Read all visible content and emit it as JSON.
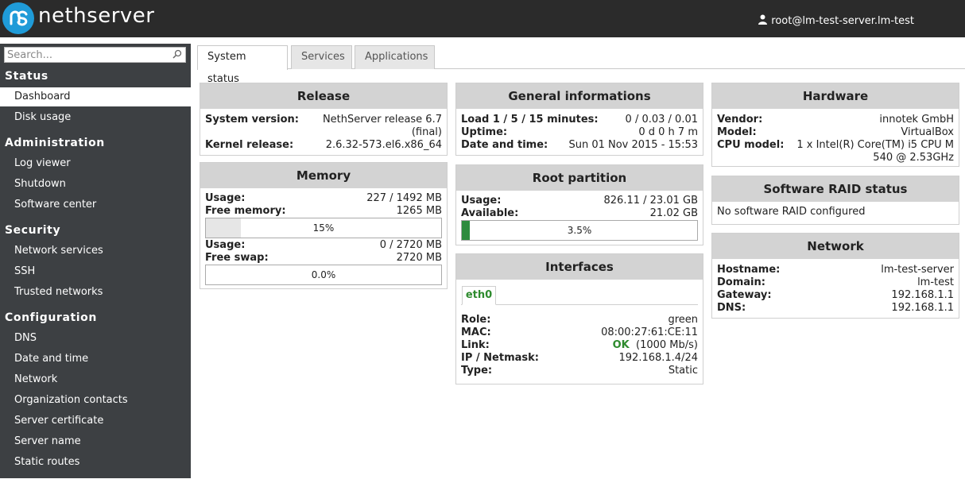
{
  "header": {
    "brand": "nethserver",
    "user": "root@lm-test-server.lm-test"
  },
  "sidebar": {
    "search_placeholder": "Search...",
    "sections": [
      {
        "title": "Status",
        "items": [
          "Dashboard",
          "Disk usage"
        ]
      },
      {
        "title": "Administration",
        "items": [
          "Log viewer",
          "Shutdown",
          "Software center"
        ]
      },
      {
        "title": "Security",
        "items": [
          "Network services",
          "SSH",
          "Trusted networks"
        ]
      },
      {
        "title": "Configuration",
        "items": [
          "DNS",
          "Date and time",
          "Network",
          "Organization contacts",
          "Server certificate",
          "Server name",
          "Static routes"
        ]
      }
    ],
    "active_item": "Dashboard"
  },
  "tabs": [
    "System status",
    "Services",
    "Applications"
  ],
  "release": {
    "title": "Release",
    "system_version_label": "System version:",
    "system_version_line1": "NethServer release 6.7",
    "system_version_line2": "(final)",
    "kernel_label": "Kernel release:",
    "kernel_value": "2.6.32-573.el6.x86_64"
  },
  "memory": {
    "title": "Memory",
    "usage_label": "Usage:",
    "usage_value": "227 / 1492 MB",
    "free_label": "Free memory:",
    "free_value": "1265 MB",
    "mem_bar_label": "15%",
    "mem_bar_fraction": 0.15,
    "swap_usage_label": "Usage:",
    "swap_usage_value": "0 / 2720 MB",
    "free_swap_label": "Free swap:",
    "free_swap_value": "2720 MB",
    "swap_bar_label": "0.0%",
    "swap_bar_fraction": 0.0,
    "mem_bar_color": "#e6e6e6"
  },
  "general": {
    "title": "General informations",
    "load_label": "Load 1 / 5 / 15 minutes:",
    "load_value": "0 / 0.03 / 0.01",
    "uptime_label": "Uptime:",
    "uptime_value": "0 d 0 h 7 m",
    "date_label": "Date and time:",
    "date_value": "Sun 01 Nov 2015 - 15:53"
  },
  "root_partition": {
    "title": "Root partition",
    "usage_label": "Usage:",
    "usage_value": "826.11 / 23.01 GB",
    "available_label": "Available:",
    "available_value": "21.02 GB",
    "bar_label": "3.5%",
    "bar_fraction": 0.035,
    "bar_color": "#2e8b3e"
  },
  "interfaces": {
    "title": "Interfaces",
    "tab": "eth0",
    "role_label": "Role:",
    "role_value": "green",
    "mac_label": "MAC:",
    "mac_value": "08:00:27:61:CE:11",
    "link_label": "Link:",
    "link_status": "OK",
    "link_speed": "(1000 Mb/s)",
    "ip_label": "IP / Netmask:",
    "ip_value": "192.168.1.4/24",
    "type_label": "Type:",
    "type_value": "Static"
  },
  "hardware": {
    "title": "Hardware",
    "vendor_label": "Vendor:",
    "vendor_value": "innotek GmbH",
    "model_label": "Model:",
    "model_value": "VirtualBox",
    "cpu_label": "CPU model:",
    "cpu_line1": "1 x Intel(R) Core(TM) i5 CPU M",
    "cpu_line2": "540 @ 2.53GHz"
  },
  "raid": {
    "title": "Software RAID status",
    "message": "No software RAID configured"
  },
  "network": {
    "title": "Network",
    "hostname_label": "Hostname:",
    "hostname_value": "lm-test-server",
    "domain_label": "Domain:",
    "domain_value": "lm-test",
    "gateway_label": "Gateway:",
    "gateway_value": "192.168.1.1",
    "dns_label": "DNS:",
    "dns_value": "192.168.1.1"
  }
}
